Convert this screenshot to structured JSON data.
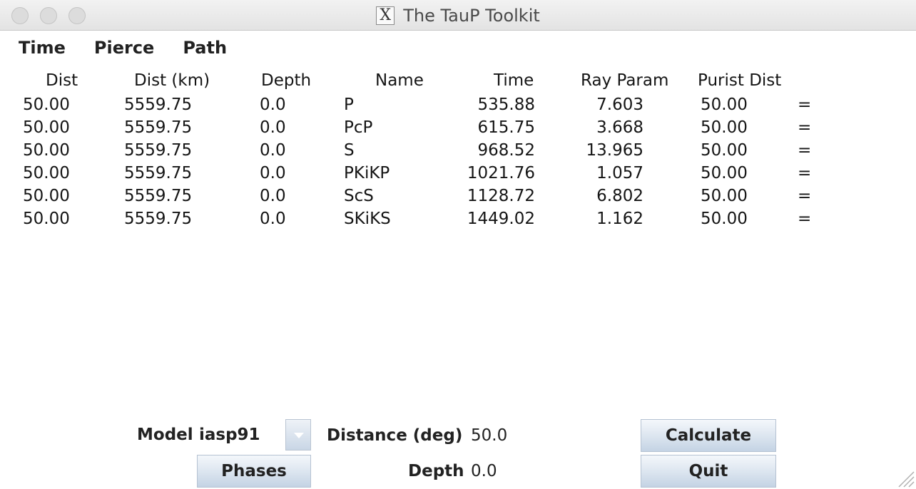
{
  "window": {
    "title": "The TauP Toolkit",
    "title_icon": "X"
  },
  "menu": {
    "items": [
      "Time",
      "Pierce",
      "Path"
    ]
  },
  "table": {
    "headers": [
      "Dist",
      "Dist (km)",
      "Depth",
      "Name",
      "Time",
      "Ray Param",
      "Purist Dist"
    ],
    "rows": [
      [
        "50.00",
        "5559.75",
        "0.0",
        "P",
        "535.88",
        "7.603",
        "50.00",
        "="
      ],
      [
        "50.00",
        "5559.75",
        "0.0",
        "PcP",
        "615.75",
        "3.668",
        "50.00",
        "="
      ],
      [
        "50.00",
        "5559.75",
        "0.0",
        "S",
        "968.52",
        "13.965",
        "50.00",
        "="
      ],
      [
        "50.00",
        "5559.75",
        "0.0",
        "PKiKP",
        "1021.76",
        "1.057",
        "50.00",
        "="
      ],
      [
        "50.00",
        "5559.75",
        "0.0",
        "ScS",
        "1128.72",
        "6.802",
        "50.00",
        "="
      ],
      [
        "50.00",
        "5559.75",
        "0.0",
        "SKiKS",
        "1449.02",
        "1.162",
        "50.00",
        "="
      ]
    ]
  },
  "controls": {
    "model_label": "Model",
    "model_value": "iasp91",
    "distance_label": "Distance (deg)",
    "distance_value": "50.0",
    "depth_label": "Depth",
    "depth_value": "0.0",
    "phases_button": "Phases",
    "calculate_button": "Calculate",
    "quit_button": "Quit"
  }
}
